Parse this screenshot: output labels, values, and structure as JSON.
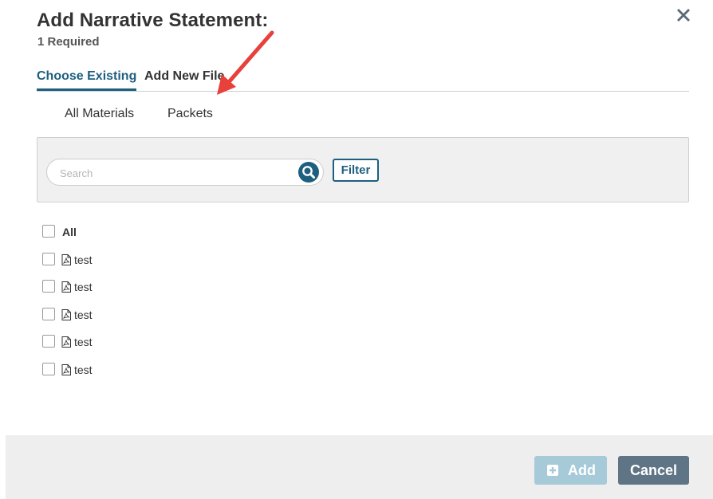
{
  "dialog": {
    "title": "Add Narrative Statement:",
    "subtitle": "1 Required",
    "close_icon": "close-icon"
  },
  "tabs": [
    {
      "label": "Choose Existing",
      "active": true
    },
    {
      "label": "Add New File",
      "active": false
    }
  ],
  "subtabs": [
    {
      "label": "All Materials"
    },
    {
      "label": "Packets"
    }
  ],
  "search": {
    "placeholder": "Search",
    "value": "",
    "icon": "search-icon",
    "filter_label": "Filter"
  },
  "list": {
    "all_label": "All",
    "items": [
      {
        "name": "test",
        "icon": "pdf-icon",
        "checked": false
      },
      {
        "name": "test",
        "icon": "pdf-icon",
        "checked": false
      },
      {
        "name": "test",
        "icon": "pdf-icon",
        "checked": false
      },
      {
        "name": "test",
        "icon": "pdf-icon",
        "checked": false
      },
      {
        "name": "test",
        "icon": "pdf-icon",
        "checked": false
      }
    ]
  },
  "footer": {
    "add_label": "Add",
    "add_icon": "plus-square-icon",
    "add_enabled": false,
    "cancel_label": "Cancel"
  },
  "colors": {
    "accent": "#1d5f7f",
    "annotation_arrow": "#e8403a",
    "add_disabled": "#a6cad8",
    "cancel": "#5f7585"
  }
}
